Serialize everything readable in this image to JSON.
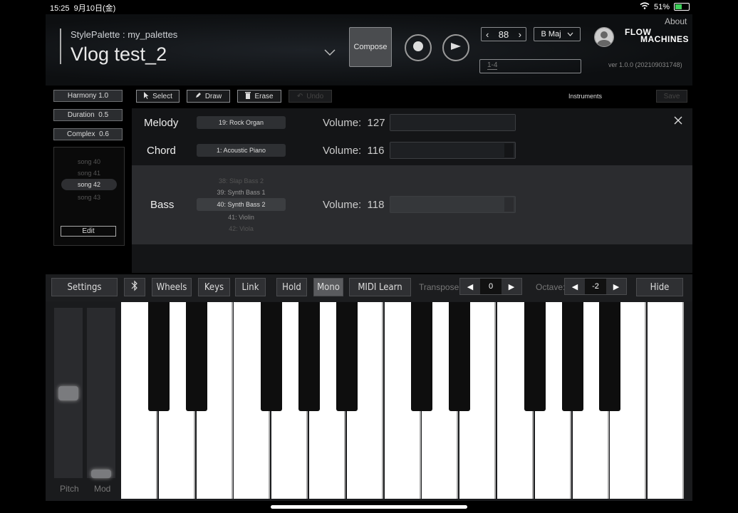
{
  "status": {
    "time": "15:25",
    "date": "9月10日(金)",
    "battery": "51%",
    "battery_level": 0.51
  },
  "header": {
    "style_palette": "StylePalette : my_palettes",
    "title": "Vlog test_2",
    "compose_label": "Compose",
    "tempo": "88",
    "key": "B Maj",
    "range": "1-4",
    "about": "About",
    "brand_line1": "FLOW",
    "brand_line2": "MACHINES",
    "version": "ver 1.0.0 (2021090317​48)"
  },
  "params": [
    {
      "label": "Harmony",
      "value": "1.0"
    },
    {
      "label": "Duration",
      "value": "0.5"
    },
    {
      "label": "Complex",
      "value": "0.6"
    }
  ],
  "songs": [
    "song 40",
    "song 41",
    "song 42",
    "song 43"
  ],
  "selected_song": "song 42",
  "edit_label": "Edit",
  "tools": {
    "select": "Select",
    "draw": "Draw",
    "erase": "Erase",
    "undo": "Undo",
    "instruments": "Instruments",
    "save": "Save"
  },
  "instruments": [
    {
      "name": "Melody",
      "program": "19: Rock Organ",
      "volume_label": "Volume:",
      "volume": "127"
    },
    {
      "name": "Chord",
      "program": "1: Acoustic Piano",
      "volume_label": "Volume:",
      "volume": "116"
    },
    {
      "name": "Bass",
      "program": "40: Synth Bass 2",
      "volume_label": "Volume:",
      "volume": "118",
      "options": [
        "38: Slap Bass 2",
        "39: Synth Bass 1",
        "40: Synth Bass 2",
        "41: Violin",
        "42: Viola"
      ]
    }
  ],
  "keyboard": {
    "settings": "Settings",
    "wheels": "Wheels",
    "keys": "Keys",
    "link": "Link",
    "hold": "Hold",
    "mono": "Mono",
    "midi_learn": "MIDI Learn",
    "transpose_label": "Transpose:",
    "transpose": "0",
    "octave_label": "Octave:",
    "octave": "-2",
    "hide": "Hide",
    "pitch": "Pitch",
    "mod": "Mod"
  },
  "colors": {
    "accent_battery": "#3fcf5a",
    "background": "#000000"
  }
}
